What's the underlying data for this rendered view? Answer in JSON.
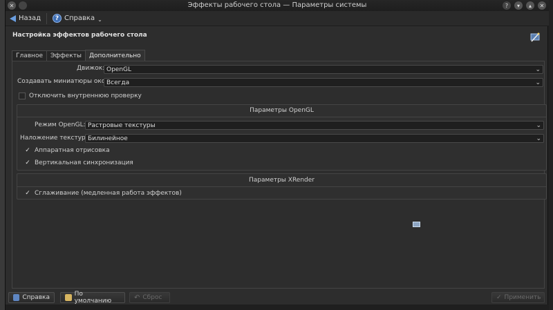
{
  "window": {
    "title": "Эффекты рабочего стола — Параметры системы"
  },
  "toolbar": {
    "back_label": "Назад",
    "help_label": "Справка"
  },
  "header": {
    "title": "Настройка эффектов рабочего стола"
  },
  "tabs": [
    {
      "label": "Главное"
    },
    {
      "label": "Эффекты"
    },
    {
      "label": "Дополнительно"
    }
  ],
  "advanced": {
    "engine_label": "Движок:",
    "engine_value": "OpenGL",
    "thumbnails_label": "Создавать миниатюры окон",
    "thumbnails_value": "Всегда",
    "disable_check_label": "Отключить внутреннюю проверку",
    "disable_check_checked": false
  },
  "opengl": {
    "group_title": "Параметры OpenGL",
    "mode_label": "Режим OpenGL:",
    "mode_value": "Растровые текстуры",
    "filter_label": "Наложение текстур:",
    "filter_value": "Билинейное",
    "hw_render_label": "Аппаратная отрисовка",
    "hw_render_checked": true,
    "vsync_label": "Вертикальная синхронизация",
    "vsync_checked": true
  },
  "xrender": {
    "group_title": "Параметры XRender",
    "smooth_label": "Сглаживание (медленная работа эффектов)",
    "smooth_checked": true
  },
  "buttons": {
    "help": "Справка",
    "defaults": "По умолчанию",
    "reset": "Сброс",
    "apply": "Применить"
  },
  "colors": {
    "background": "#2d2d2d",
    "accent": "#6a9ee0"
  }
}
